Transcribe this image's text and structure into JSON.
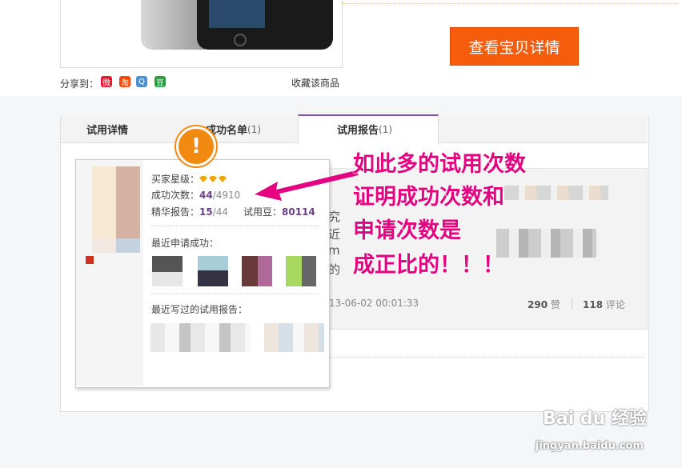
{
  "product": {
    "view_button": "查看宝贝详情",
    "share_label": "分享到：",
    "collect_label": "收藏该商品",
    "share_icons": [
      {
        "name": "weibo-icon",
        "glyph": "微",
        "color": "#e6162d"
      },
      {
        "name": "taobao-icon",
        "glyph": "淘",
        "color": "#ff4400"
      },
      {
        "name": "qzone-icon",
        "glyph": "Q",
        "color": "#4a90d9"
      },
      {
        "name": "douban-icon",
        "glyph": "豆",
        "color": "#2c9b3f"
      }
    ]
  },
  "tabs": [
    {
      "label": "试用详情",
      "count": ""
    },
    {
      "label": "成功名单",
      "count": "(1)"
    },
    {
      "label": "试用报告",
      "count": "(1)"
    }
  ],
  "report": {
    "date": "13-06-02 00:01:33",
    "likes": "290",
    "likes_label": "赞",
    "comments": "118",
    "comments_label": "评论",
    "sep": "|",
    "frag1": "究",
    "frag2": "近",
    "frag3": "m",
    "frag4": "的"
  },
  "popup": {
    "buyer_level_label": "买家星级：",
    "success_label": "成功次数：",
    "success_num": "44",
    "success_total": "/4910",
    "elite_label": "精华报告：",
    "elite_num": "15",
    "elite_total": "/44",
    "beans_label": "试用豆：",
    "beans_num": "80114",
    "recent_apply": "最近申请成功：",
    "recent_report": "最近写过的试用报告："
  },
  "annotation": [
    "如此多的试用次数",
    "证明成功次数和",
    "申请次数是",
    "成正比的！！！"
  ],
  "warning_glyph": "!",
  "watermark": {
    "main": "Bai du 经验",
    "sub": "jingyan.baidu.com"
  }
}
